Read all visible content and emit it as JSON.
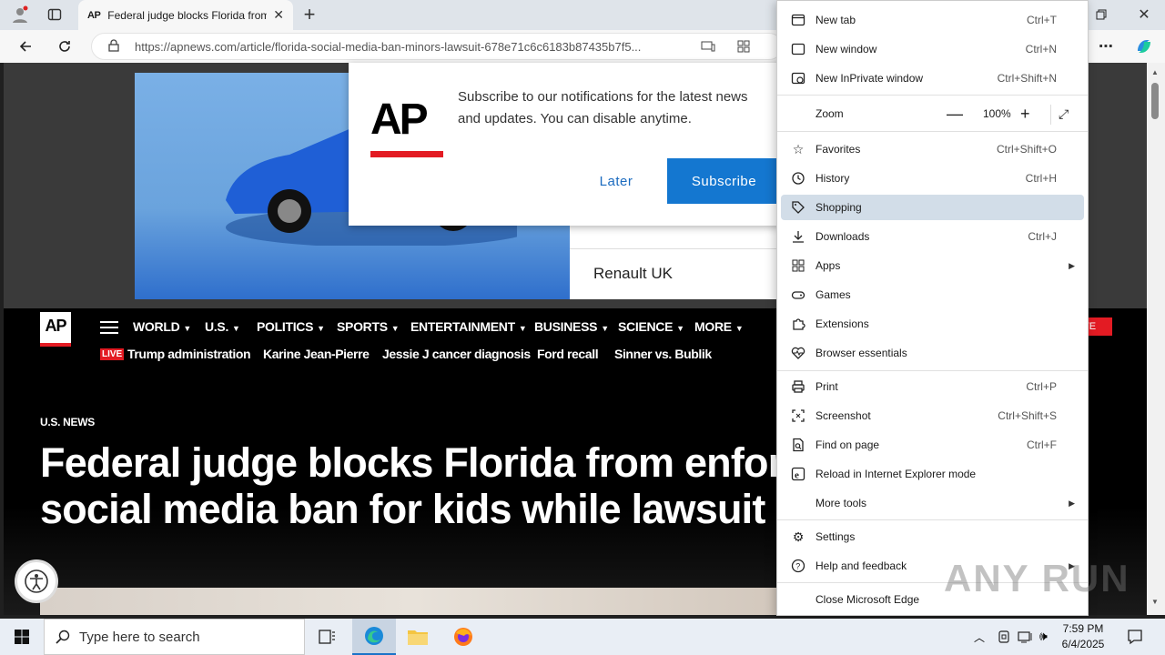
{
  "browser": {
    "tab_title": "Federal judge blocks Florida from",
    "tab_favicon": "AP",
    "url": "https://apnews.com/article/florida-social-media-ban-minors-lawsuit-678e71c6c6183b87435b7f5..."
  },
  "ad": {
    "advertiser": "Renault UK"
  },
  "popup": {
    "logo": "AP",
    "message": "Subscribe to our notifications for the latest news and updates. You can disable anytime.",
    "later": "Later",
    "subscribe": "Subscribe"
  },
  "nav": {
    "logo": "AP",
    "items": [
      "WORLD",
      "U.S.",
      "POLITICS",
      "SPORTS",
      "ENTERTAINMENT",
      "BUSINESS",
      "SCIENCE",
      "MORE"
    ],
    "live_badge": "LIVE",
    "trending": [
      "Trump administration",
      "Karine Jean-Pierre",
      "Jessie J cancer diagnosis",
      "Ford recall",
      "Sinner vs. Bublik"
    ],
    "cta_fragment": "TE"
  },
  "article": {
    "kicker": "U.S. NEWS",
    "headline_line1": "Federal judge blocks Florida from enforci",
    "headline_line2": "social media ban for kids while lawsuit co"
  },
  "menu": {
    "items": [
      {
        "label": "New tab",
        "shortcut": "Ctrl+T",
        "icon": "new-tab-icon"
      },
      {
        "label": "New window",
        "shortcut": "Ctrl+N",
        "icon": "new-window-icon"
      },
      {
        "label": "New InPrivate window",
        "shortcut": "Ctrl+Shift+N",
        "icon": "inprivate-icon"
      },
      {
        "label": "Favorites",
        "shortcut": "Ctrl+Shift+O",
        "icon": "star-icon"
      },
      {
        "label": "History",
        "shortcut": "Ctrl+H",
        "icon": "history-icon"
      },
      {
        "label": "Shopping",
        "shortcut": "",
        "icon": "tag-icon"
      },
      {
        "label": "Downloads",
        "shortcut": "Ctrl+J",
        "icon": "download-icon"
      },
      {
        "label": "Apps",
        "shortcut": "",
        "icon": "apps-icon"
      },
      {
        "label": "Games",
        "shortcut": "",
        "icon": "games-icon"
      },
      {
        "label": "Extensions",
        "shortcut": "",
        "icon": "puzzle-icon"
      },
      {
        "label": "Browser essentials",
        "shortcut": "",
        "icon": "heart-pulse-icon"
      },
      {
        "label": "Print",
        "shortcut": "Ctrl+P",
        "icon": "print-icon"
      },
      {
        "label": "Screenshot",
        "shortcut": "Ctrl+Shift+S",
        "icon": "screenshot-icon"
      },
      {
        "label": "Find on page",
        "shortcut": "Ctrl+F",
        "icon": "find-icon"
      },
      {
        "label": "Reload in Internet Explorer mode",
        "shortcut": "",
        "icon": "ie-icon"
      },
      {
        "label": "More tools",
        "shortcut": "",
        "icon": ""
      },
      {
        "label": "Settings",
        "shortcut": "",
        "icon": "gear-icon"
      },
      {
        "label": "Help and feedback",
        "shortcut": "",
        "icon": "help-icon"
      },
      {
        "label": "Close Microsoft Edge",
        "shortcut": "",
        "icon": ""
      }
    ],
    "zoom_label": "Zoom",
    "zoom_value": "100%",
    "highlighted": "Shopping"
  },
  "watermark": "ANY RUN",
  "taskbar": {
    "search_placeholder": "Type here to search",
    "time": "7:59 PM",
    "date": "6/4/2025"
  }
}
